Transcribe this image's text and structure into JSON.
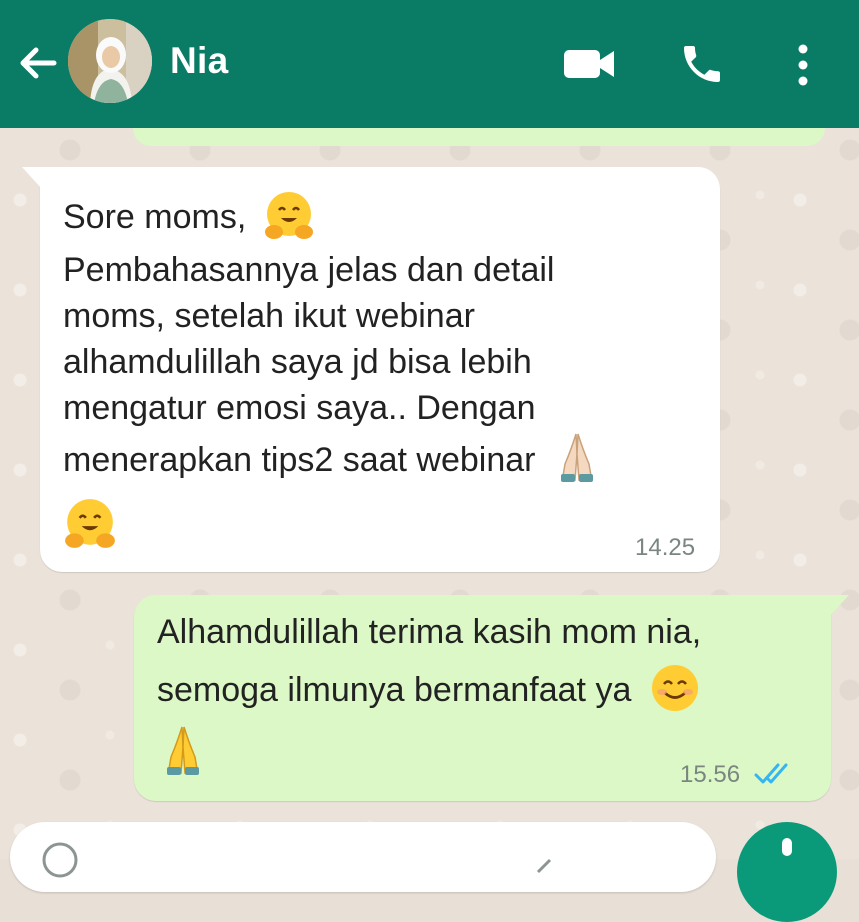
{
  "header": {
    "contact_name": "Nia",
    "background_color": "#0a7c65",
    "icons": [
      "back-arrow-icon",
      "avatar",
      "video-call-icon",
      "phone-icon",
      "more-options-icon"
    ]
  },
  "messages": [
    {
      "direction": "incoming",
      "lines": [
        "Sore moms,",
        "Pembahasannya jelas dan detail",
        "moms, setelah ikut webinar",
        "alhamdulillah saya jd bisa lebih",
        "mengatur emosi saya.. Dengan",
        "menerapkan tips2 saat webinar"
      ],
      "emojis": [
        "hugging-face-emoji",
        "folded-hands-emoji",
        "hugging-face-emoji"
      ],
      "time": "14.25"
    },
    {
      "direction": "outgoing",
      "lines": [
        "Alhamdulillah terima kasih mom nia,",
        "semoga ilmunya bermanfaat ya"
      ],
      "emojis": [
        "smiling-face-emoji",
        "folded-hands-emoji"
      ],
      "time": "15.56",
      "status": "read-double-check-icon"
    }
  ],
  "colors": {
    "incoming_bubble": "#ffffff",
    "outgoing_bubble": "#dcf8c6",
    "read_tick": "#34b7f1",
    "fab": "#0a9a7a"
  }
}
